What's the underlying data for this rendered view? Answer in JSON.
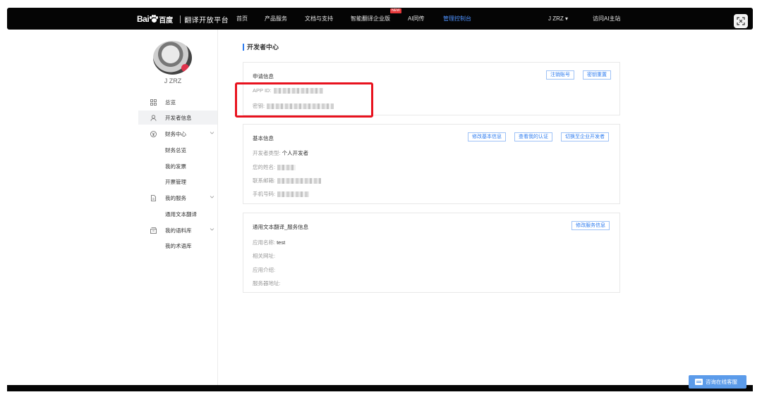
{
  "header": {
    "logo_bai": "Bai",
    "logo_cn": "百度",
    "logo_title": "翻译开放平台",
    "nav": [
      {
        "label": "首页",
        "active": false
      },
      {
        "label": "产品服务",
        "active": false
      },
      {
        "label": "文档与支持",
        "active": false
      },
      {
        "label": "智能翻译企业版",
        "active": false,
        "badge": "NEW"
      },
      {
        "label": "AI同传",
        "active": false
      },
      {
        "label": "管理控制台",
        "active": true
      }
    ],
    "user_menu": "J ZRZ ▾",
    "visit_link": "访问AI主站"
  },
  "sidebar": {
    "user_name": "J ZRZ",
    "items": [
      {
        "label": "总览",
        "icon": "grid-icon"
      },
      {
        "label": "开发者信息",
        "icon": "user-icon",
        "active": true
      },
      {
        "label": "财务中心",
        "icon": "yen-icon",
        "expandable": true
      },
      {
        "label": "财务总览"
      },
      {
        "label": "我的发票"
      },
      {
        "label": "开票管理"
      },
      {
        "label": "我的服务",
        "icon": "document-icon",
        "expandable": true
      },
      {
        "label": "通用文本翻译"
      },
      {
        "label": "我的语料库",
        "icon": "box-icon",
        "expandable": true
      },
      {
        "label": "我的术语库"
      }
    ]
  },
  "main": {
    "page_title": "开发者中心",
    "apply_card": {
      "title": "申请信息",
      "app_id_label": "APP ID:",
      "secret_label": "密钥:",
      "btn_logout": "注销账号",
      "btn_reset": "密钥重置"
    },
    "basic_card": {
      "title": "基本信息",
      "dev_type_label": "开发者类型:",
      "dev_type_value": "个人开发者",
      "name_label": "您的姓名:",
      "email_label": "联系邮箱:",
      "phone_label": "手机号码:",
      "btn_edit": "修改基本信息",
      "btn_verify": "查看我的认证",
      "btn_switch": "切换至企业开发者"
    },
    "service_card": {
      "title": "通用文本翻译_服务信息",
      "app_name_label": "应用名称:",
      "app_name_value": "test",
      "url_label": "相关网址:",
      "intro_label": "应用介绍:",
      "server_label": "服务器地址:",
      "btn_edit": "修改服务信息"
    }
  },
  "chat": {
    "label": "咨询在线客服"
  },
  "colors": {
    "accent": "#2d7cf0",
    "highlight": "#e8121e",
    "topbar": "#050505"
  }
}
